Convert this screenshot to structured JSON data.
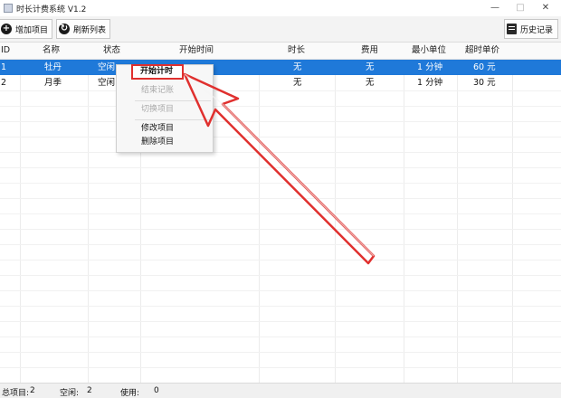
{
  "window": {
    "title": "时长计费系统 V1.2",
    "minimize": "—",
    "maximize": "□",
    "close": "✕"
  },
  "toolbar": {
    "add_label": "增加项目",
    "refresh_label": "刷新列表",
    "history_label": "历史记录"
  },
  "table": {
    "columns": [
      "ID",
      "名称",
      "状态",
      "开始时间",
      "时长",
      "费用",
      "最小单位",
      "超时单价"
    ],
    "rows": [
      [
        "1",
        "牡丹",
        "空闲",
        "",
        "无",
        "无",
        "1 分钟",
        "60 元"
      ],
      [
        "2",
        "月季",
        "空闲",
        "",
        "无",
        "无",
        "1 分钟",
        "30 元"
      ]
    ],
    "selected_row": 0
  },
  "context_menu": {
    "items": [
      {
        "label": "开始计时",
        "enabled": true
      },
      {
        "label": "结束记账",
        "enabled": false
      },
      {
        "label": "切换项目",
        "enabled": false
      },
      {
        "label": "修改项目",
        "enabled": true
      },
      {
        "label": "删除项目",
        "enabled": true
      }
    ]
  },
  "status": {
    "total_label": "总项目:",
    "total_value": "2",
    "idle_label": "空闲:",
    "idle_value": "2",
    "used_label": "使用:",
    "used_value": "0"
  },
  "colors": {
    "selection": "#1f79d9",
    "highlight": "#e0302e"
  },
  "icons": {
    "add": "plus-circle-icon",
    "refresh": "refresh-circle-icon",
    "history": "document-icon"
  }
}
